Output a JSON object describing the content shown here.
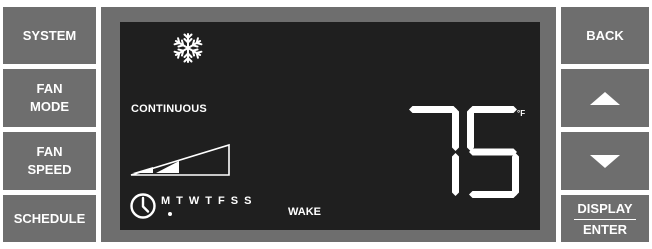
{
  "left_buttons": {
    "system": "SYSTEM",
    "fan_mode": [
      "FAN",
      "MODE"
    ],
    "fan_speed": [
      "FAN",
      "SPEED"
    ],
    "schedule": "SCHEDULE"
  },
  "right_buttons": {
    "back": "BACK",
    "up_icon": "triangle-up",
    "down_icon": "triangle-down",
    "display": "DISPLAY",
    "enter": "ENTER"
  },
  "lcd": {
    "mode_icon": "snowflake",
    "fan_label": "CONTINUOUS",
    "fan_speed_level": 0.5,
    "clock_icon": "clock",
    "days": [
      "M",
      "T",
      "W",
      "T",
      "F",
      "S",
      "S"
    ],
    "active_day_index": 0,
    "period": "WAKE",
    "temperature": "75",
    "unit": "°F"
  },
  "colors": {
    "panel": "#6e6e6e",
    "lcd_background": "#1f1f1f",
    "lcd_segments": "#ffffff"
  }
}
